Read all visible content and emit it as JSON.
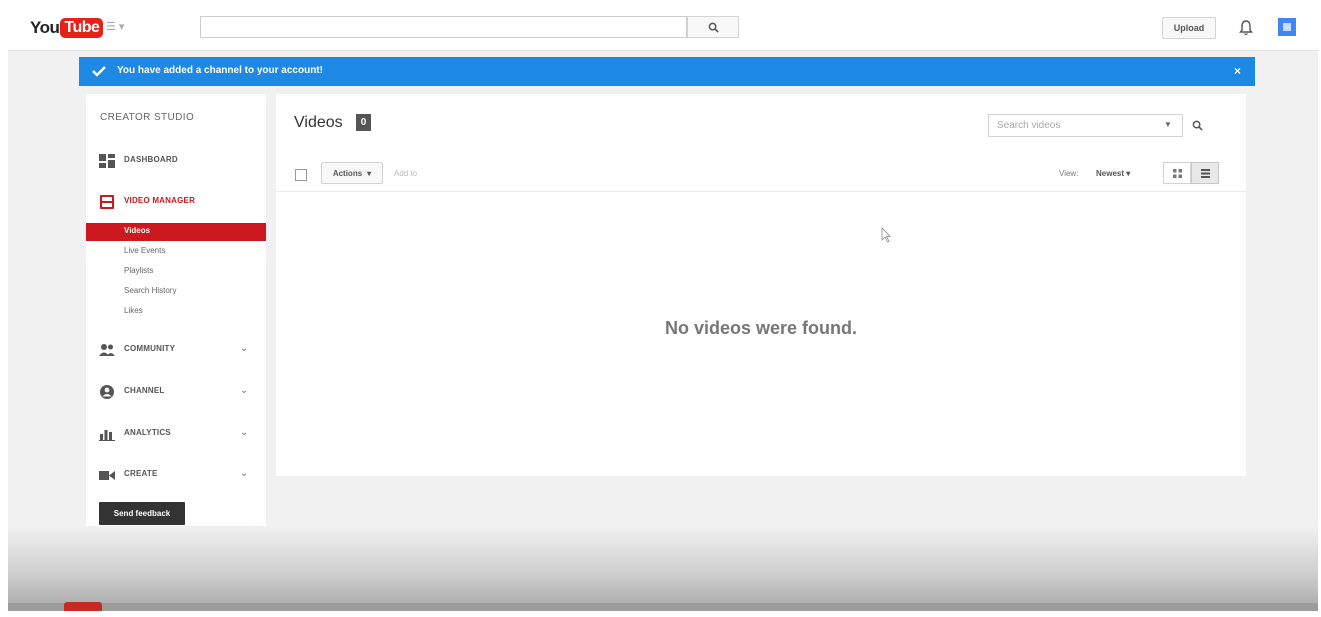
{
  "topbar": {
    "logo": {
      "you": "You",
      "tube": "Tube"
    },
    "guide_label": "☰ ▾",
    "search_button_icon": "search-icon",
    "upload_label": "Upload",
    "notifications_icon": "bell-icon",
    "accent": "#e62117"
  },
  "alert": {
    "message": "You have added a channel to your account!",
    "close": "×",
    "color": "#1e88e5"
  },
  "sidebar": {
    "title": "CREATOR STUDIO",
    "sections": [
      {
        "label": "DASHBOARD",
        "icon": "dashboard-icon"
      },
      {
        "label": "VIDEO MANAGER",
        "icon": "video-manager-icon"
      },
      {
        "label": "COMMUNITY",
        "icon": "community-icon"
      },
      {
        "label": "CHANNEL",
        "icon": "channel-icon"
      },
      {
        "label": "ANALYTICS",
        "icon": "analytics-icon"
      },
      {
        "label": "CREATE",
        "icon": "create-icon"
      }
    ],
    "video_manager_items": [
      "Videos",
      "Live Events",
      "Playlists",
      "Search History",
      "Likes"
    ],
    "active_item": "Videos",
    "feedback_label": "Send feedback",
    "active_color": "#cc181e"
  },
  "main": {
    "title": "Videos",
    "count": "0",
    "search_placeholder": "Search videos",
    "actions_label": "Actions",
    "add_to_label": "Add to",
    "view_label": "View:",
    "sort_label": "Newest",
    "empty_message": "No videos were found."
  }
}
